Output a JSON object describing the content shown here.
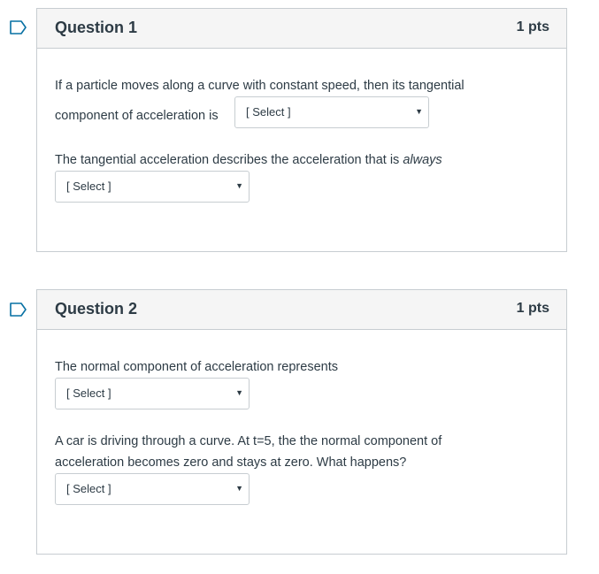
{
  "questions": [
    {
      "title": "Question 1",
      "points": "1 pts",
      "line1": "If a particle moves along a curve with constant speed, then its tangential",
      "line2_prefix": "component of acceleration is",
      "select1": "[ Select ]",
      "line3_prefix": "The tangential acceleration describes the acceleration that is ",
      "line3_em": "always",
      "select2": "[ Select ]"
    },
    {
      "title": "Question 2",
      "points": "1 pts",
      "line1": "The normal component of acceleration represents",
      "select1": "[ Select ]",
      "line2": "A car is driving through a curve. At t=5, the the normal component of",
      "line3": "acceleration becomes zero and stays at zero. What happens?",
      "select2": "[ Select ]"
    }
  ],
  "icons": {
    "flag": "bookmark-flag-icon",
    "caret": "caret-down-icon"
  },
  "colors": {
    "flag": "#0770a3",
    "header_bg": "#f5f5f5",
    "border": "#c7cdd1",
    "text": "#2d3b45"
  }
}
